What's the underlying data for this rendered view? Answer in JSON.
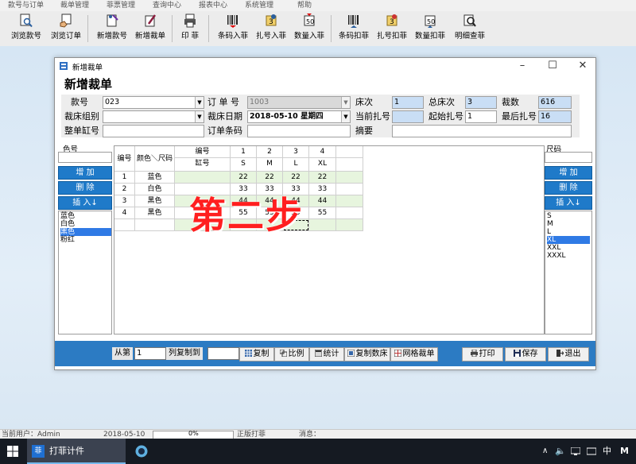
{
  "menu": [
    "款号与订单",
    "裁单管理",
    "菲票管理",
    "查询中心",
    "报表中心",
    "系统管理",
    "帮助"
  ],
  "toolbar": {
    "buttons": [
      "浏览款号",
      "浏览订单",
      "新增款号",
      "新增裁单",
      "印 菲",
      "条码入菲",
      "扎号入菲",
      "数量入菲",
      "条码扣菲",
      "扎号扣菲",
      "数量扣菲",
      "明细查菲"
    ]
  },
  "dialog": {
    "title": "新增裁单",
    "heading": "新增裁单",
    "controls": {
      "minimize": "–",
      "maximize": "☐",
      "close": "✕"
    },
    "form": {
      "style_no_label": "款号",
      "style_no_value": "023",
      "order_no_label": "订 单 号",
      "order_no_value": "1003",
      "bed_label": "床次",
      "bed_value": "1",
      "total_bed_label": "总床次",
      "total_bed_value": "3",
      "cut_count_label": "裁数",
      "cut_count_value": "616",
      "cut_group_label": "裁床组别",
      "cut_group_value": "",
      "cut_date_label": "裁床日期",
      "cut_date_value": "2018-05-10  星期四",
      "current_bundle_label": "当前扎号",
      "current_bundle_value": "",
      "start_bundle_label": "起始扎号",
      "start_bundle_value": "1",
      "last_bundle_label": "最后扎号",
      "last_bundle_value": "16",
      "whole_vat_label": "整单缸号",
      "whole_vat_value": "",
      "order_barcode_label": "订单条码",
      "order_barcode_value": "",
      "summary_label": "摘要",
      "summary_value": ""
    },
    "color_pane": {
      "label": "色号",
      "add": "增 加",
      "delete": "删 除",
      "insert": "插 入↓",
      "items": [
        "蓝色",
        "白色",
        "黑色",
        "粉红"
      ],
      "selected_index": 2
    },
    "size_pane": {
      "label": "尺码",
      "add": "增 加",
      "delete": "删 除",
      "insert": "插 入↓",
      "items": [
        "S",
        "M",
        "L",
        "XL",
        "XXL",
        "XXXL"
      ],
      "selected_index": 3
    },
    "grid": {
      "col_no": "编号",
      "col_color_size": "颜色＼尺码",
      "col_code": "编号",
      "col_vat": "缸号",
      "size_numbers": [
        "1",
        "2",
        "3",
        "4"
      ],
      "sizes": [
        "S",
        "M",
        "L",
        "XL"
      ],
      "rows": [
        {
          "no": "1",
          "color": "蓝色",
          "values": [
            "22",
            "22",
            "22",
            "22"
          ]
        },
        {
          "no": "2",
          "color": "白色",
          "values": [
            "33",
            "33",
            "33",
            "33"
          ]
        },
        {
          "no": "3",
          "color": "黑色",
          "values": [
            "44",
            "44",
            "44",
            "44"
          ]
        },
        {
          "no": "4",
          "color": "黑色",
          "values": [
            "55",
            "55",
            "55",
            "55"
          ]
        }
      ]
    },
    "watermark": "第二步",
    "bottom": {
      "from_label": "从第",
      "from_value": "1",
      "copy_to_label": "列复制到",
      "copy_to_value": "",
      "copy": "复制",
      "ratio": "比例",
      "stats": "统计",
      "copy_bed": "复制数床",
      "grid_cut": "网格裁单",
      "print": "打印",
      "save": "保存",
      "exit": "退出"
    }
  },
  "statusbar": {
    "user": "当前用户：Admin",
    "date": "2018-05-10",
    "progress": "0%",
    "progress_fraction": 0,
    "edition": "正版打菲",
    "message": "消息："
  },
  "taskbar": {
    "app_name": "打菲计件",
    "app_badge": "菲",
    "ime": "中",
    "ime2": "M"
  },
  "colors": {
    "accent_blue": "#1f7ac9",
    "bottom_bar": "#2c7bc3",
    "watermark": "#ff1f1f",
    "row_green": "#e7f5de"
  }
}
